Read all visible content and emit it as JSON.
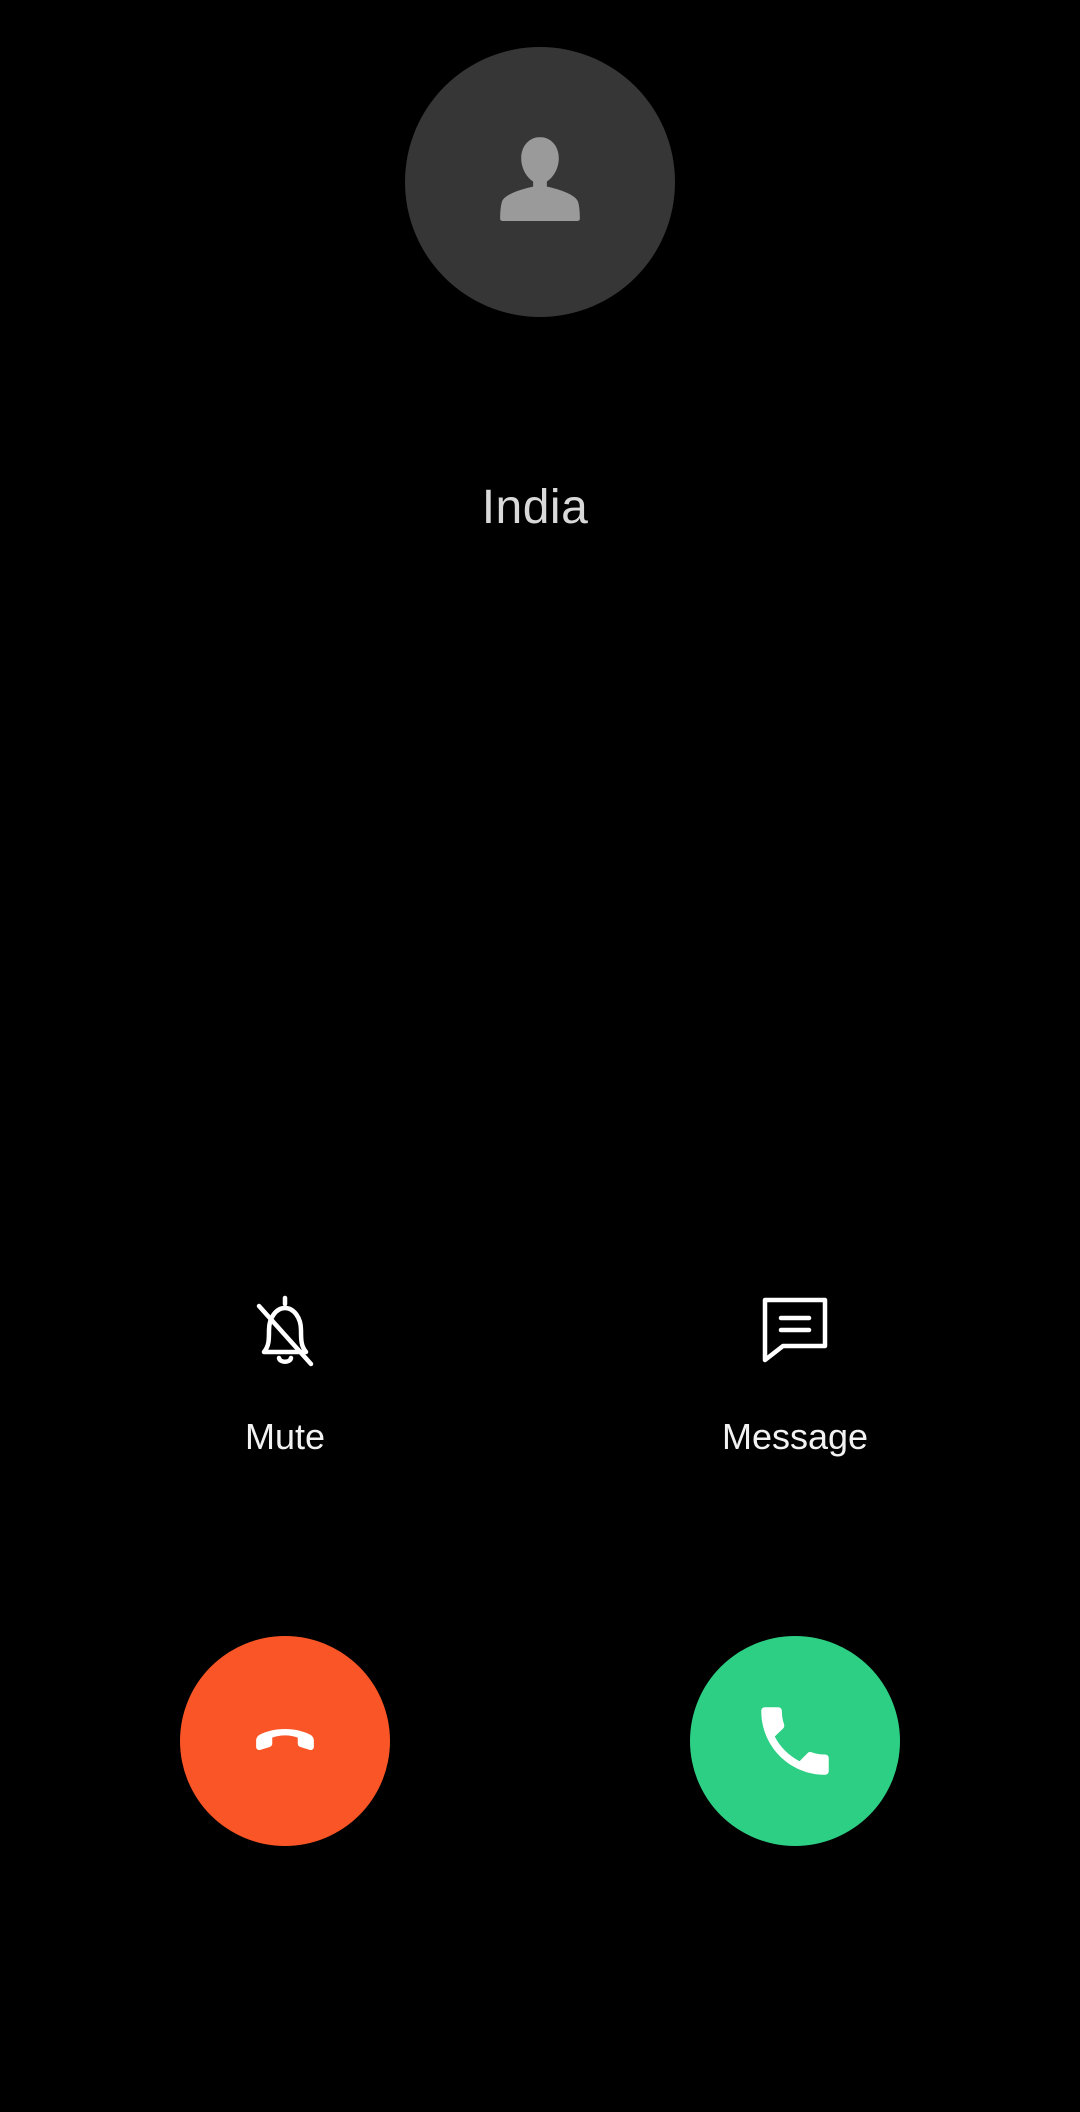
{
  "caller": {
    "name": "India",
    "avatar_icon": "person-silhouette-icon"
  },
  "actions": {
    "mute_label": "Mute",
    "mute_icon": "bell-off-icon",
    "message_label": "Message",
    "message_icon": "chat-bubble-icon"
  },
  "buttons": {
    "decline_icon": "phone-hangup-icon",
    "answer_icon": "phone-answer-icon"
  },
  "colors": {
    "background": "#000000",
    "avatar_bg": "#363636",
    "decline": "#f95526",
    "answer": "#2dcf84"
  }
}
